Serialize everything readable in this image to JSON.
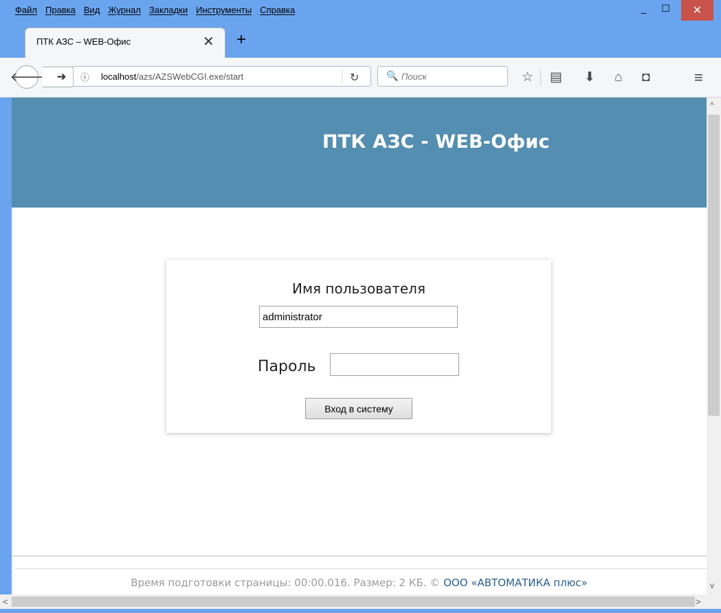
{
  "menu": [
    "Файл",
    "Правка",
    "Вид",
    "Журнал",
    "Закладки",
    "Инструменты",
    "Справка"
  ],
  "window": {
    "minimize": "_",
    "maximize": "☐",
    "close": "✕"
  },
  "tab": {
    "title": "ПТК АЗС – WEB-Офис",
    "close": "✕",
    "new_tab": "+"
  },
  "nav": {
    "back": "🡐",
    "forward": "➜",
    "info": "ⓘ",
    "url_host": "localhost",
    "url_path": "/azs/AZSWebCGI.exe/start",
    "reload": "↻",
    "search_icon": "🔍",
    "search_placeholder": "Поиск",
    "star": "☆",
    "reading": "▤",
    "download": "⬇",
    "home": "⌂",
    "pocket": "◘",
    "menu": "≡"
  },
  "page": {
    "title": "ПТК АЗС - WEB-Офис",
    "username_label": "Имя пользователя",
    "username_value": "administrator",
    "password_label": "Пароль",
    "login_button": "Вход в систему",
    "footer_text": "Время подготовки страницы: 00:00.016. Размер: 2 КБ. ©",
    "footer_link": "ООО «АВТОМАТИКА плюс»"
  },
  "scroll": {
    "up": "^",
    "down": "v",
    "left": "<",
    "right": ">"
  },
  "colors": {
    "header": "#548eb1",
    "chrome": "#6aa4ef",
    "close": "#c7534a"
  }
}
